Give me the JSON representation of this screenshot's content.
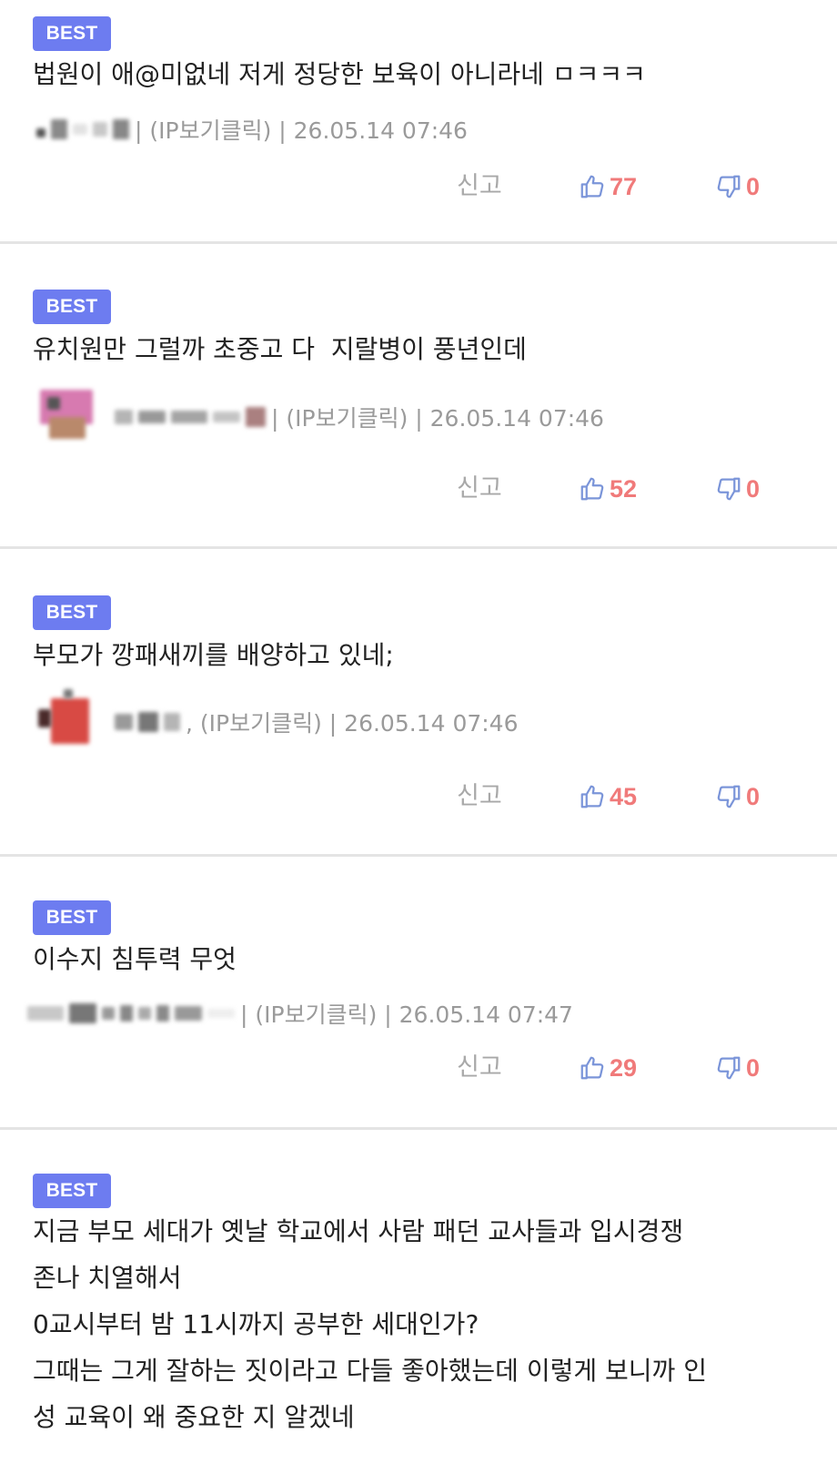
{
  "comments": [
    {
      "badge": "BEST",
      "text": "법원이 애@미없네 저게 정당한 보육이 아니라네 ㅁㅋㅋㅋ",
      "ip_label": "| (IP보기클릭) | 26.05.14 07:46",
      "report": "신고",
      "likes": "77",
      "dislikes": "0"
    },
    {
      "badge": "BEST",
      "text": "유치원만 그럴까 초중고 다  지랄병이 풍년인데",
      "ip_label": "| (IP보기클릭) | 26.05.14 07:46",
      "report": "신고",
      "likes": "52",
      "dislikes": "0"
    },
    {
      "badge": "BEST",
      "text": "부모가 깡패새끼를 배양하고 있네;",
      "ip_label": ", (IP보기클릭) | 26.05.14 07:46",
      "report": "신고",
      "likes": "45",
      "dislikes": "0"
    },
    {
      "badge": "BEST",
      "text": "이수지 침투력 무엇",
      "ip_label": "| (IP보기클릭) | 26.05.14 07:47",
      "report": "신고",
      "likes": "29",
      "dislikes": "0"
    },
    {
      "badge": "BEST",
      "text": "지금 부모 세대가 옛날 학교에서 사람 패던 교사들과 입시경쟁\n존나 치열해서\n0교시부터 밤 11시까지 공부한 세대인가?\n그때는 그게 잘하는 짓이라고 다들 좋아했는데 이렇게 보니까 인\n성 교육이 왜 중요한 지 알겠네"
    }
  ],
  "colors": {
    "badge_bg": "#6d7cf0",
    "count": "#f07a7a",
    "icon": "#7b95d9",
    "meta": "#9a9a9a",
    "divider": "#e4e4e4"
  },
  "icons": {
    "like": "thumbs-up-icon",
    "dislike": "thumbs-down-icon"
  }
}
